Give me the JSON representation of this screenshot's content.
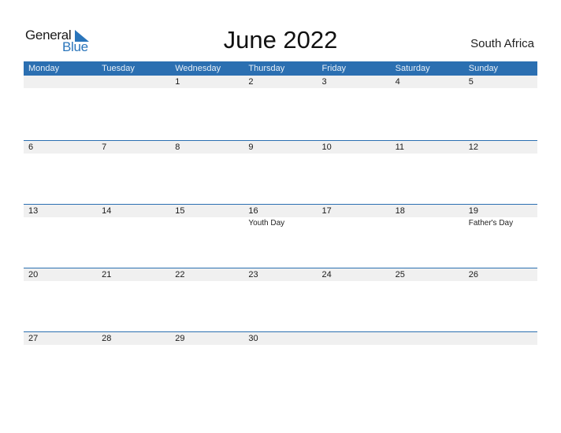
{
  "logo": {
    "line1": "General",
    "line2": "Blue"
  },
  "title": "June 2022",
  "country": "South Africa",
  "weekdays": [
    "Monday",
    "Tuesday",
    "Wednesday",
    "Thursday",
    "Friday",
    "Saturday",
    "Sunday"
  ],
  "weeks": [
    {
      "days": [
        {
          "num": "",
          "holiday": ""
        },
        {
          "num": "",
          "holiday": ""
        },
        {
          "num": "1",
          "holiday": ""
        },
        {
          "num": "2",
          "holiday": ""
        },
        {
          "num": "3",
          "holiday": ""
        },
        {
          "num": "4",
          "holiday": ""
        },
        {
          "num": "5",
          "holiday": ""
        }
      ]
    },
    {
      "days": [
        {
          "num": "6",
          "holiday": ""
        },
        {
          "num": "7",
          "holiday": ""
        },
        {
          "num": "8",
          "holiday": ""
        },
        {
          "num": "9",
          "holiday": ""
        },
        {
          "num": "10",
          "holiday": ""
        },
        {
          "num": "11",
          "holiday": ""
        },
        {
          "num": "12",
          "holiday": ""
        }
      ]
    },
    {
      "days": [
        {
          "num": "13",
          "holiday": ""
        },
        {
          "num": "14",
          "holiday": ""
        },
        {
          "num": "15",
          "holiday": ""
        },
        {
          "num": "16",
          "holiday": "Youth Day"
        },
        {
          "num": "17",
          "holiday": ""
        },
        {
          "num": "18",
          "holiday": ""
        },
        {
          "num": "19",
          "holiday": "Father's Day"
        }
      ]
    },
    {
      "days": [
        {
          "num": "20",
          "holiday": ""
        },
        {
          "num": "21",
          "holiday": ""
        },
        {
          "num": "22",
          "holiday": ""
        },
        {
          "num": "23",
          "holiday": ""
        },
        {
          "num": "24",
          "holiday": ""
        },
        {
          "num": "25",
          "holiday": ""
        },
        {
          "num": "26",
          "holiday": ""
        }
      ]
    },
    {
      "days": [
        {
          "num": "27",
          "holiday": ""
        },
        {
          "num": "28",
          "holiday": ""
        },
        {
          "num": "29",
          "holiday": ""
        },
        {
          "num": "30",
          "holiday": ""
        },
        {
          "num": "",
          "holiday": ""
        },
        {
          "num": "",
          "holiday": ""
        },
        {
          "num": "",
          "holiday": ""
        }
      ]
    }
  ],
  "colors": {
    "accent": "#2b6fb1",
    "band": "#f0f0f0",
    "logo_blue": "#2a75bb"
  }
}
